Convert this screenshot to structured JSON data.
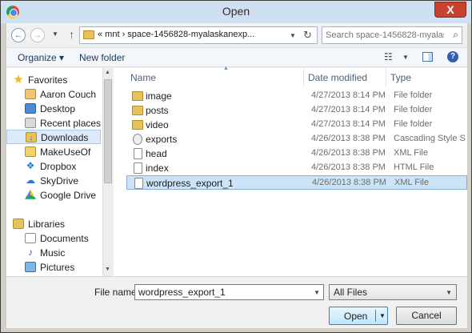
{
  "window": {
    "title": "Open",
    "close_label": "X"
  },
  "address": {
    "back_glyph": "←",
    "forward_glyph": "→",
    "up_glyph": "↑",
    "path": "«  mnt  ›  space-1456828-myalaskanexp...",
    "refresh_glyph": "↻"
  },
  "search": {
    "placeholder": "Search space-1456828-myalas..."
  },
  "toolbar": {
    "organize_label": "Organize ▾",
    "new_folder_label": "New folder",
    "help_label": "?"
  },
  "nav": {
    "favorites_label": "Favorites",
    "items": [
      {
        "label": "Aaron Couch",
        "icon": "user-folder-icon"
      },
      {
        "label": "Desktop",
        "icon": "desktop-icon"
      },
      {
        "label": "Recent places",
        "icon": "recent-places-icon"
      },
      {
        "label": "Downloads",
        "icon": "downloads-icon"
      },
      {
        "label": "MakeUseOf",
        "icon": "folder-icon"
      },
      {
        "label": "Dropbox",
        "icon": "dropbox-icon"
      },
      {
        "label": "SkyDrive",
        "icon": "skydrive-icon"
      },
      {
        "label": "Google Drive",
        "icon": "google-drive-icon"
      }
    ],
    "libraries_label": "Libraries",
    "library_items": [
      {
        "label": "Documents",
        "icon": "documents-icon"
      },
      {
        "label": "Music",
        "icon": "music-icon"
      },
      {
        "label": "Pictures",
        "icon": "pictures-icon"
      }
    ],
    "selected": "Downloads"
  },
  "columns": {
    "name": "Name",
    "date": "Date modified",
    "type": "Type"
  },
  "files": [
    {
      "name": "image",
      "date": "4/27/2013 8:14 PM",
      "type": "File folder",
      "icon": "folder-icon"
    },
    {
      "name": "posts",
      "date": "4/27/2013 8:14 PM",
      "type": "File folder",
      "icon": "folder-icon"
    },
    {
      "name": "video",
      "date": "4/27/2013 8:14 PM",
      "type": "File folder",
      "icon": "folder-icon"
    },
    {
      "name": "exports",
      "date": "4/26/2013 8:38 PM",
      "type": "Cascading Style S...",
      "icon": "css-file-icon"
    },
    {
      "name": "head",
      "date": "4/26/2013 8:38 PM",
      "type": "XML File",
      "icon": "file-icon"
    },
    {
      "name": "index",
      "date": "4/26/2013 8:38 PM",
      "type": "HTML File",
      "icon": "file-icon"
    },
    {
      "name": "wordpress_export_1",
      "date": "4/26/2013 8:38 PM",
      "type": "XML File",
      "icon": "file-icon",
      "selected": true
    }
  ],
  "bottom": {
    "file_name_label": "File name:",
    "file_name_value": "wordpress_export_1",
    "filter_value": "All Files",
    "open_label": "Open",
    "cancel_label": "Cancel"
  }
}
